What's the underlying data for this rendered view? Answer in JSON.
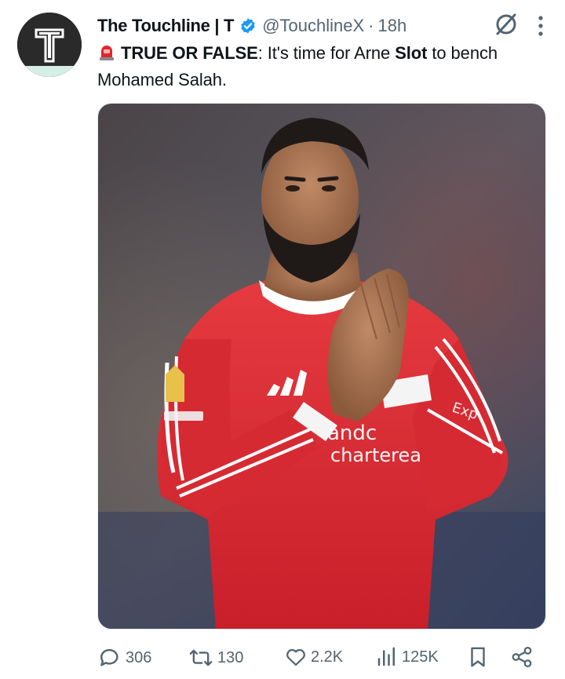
{
  "tweet": {
    "display_name": "The Touchline | T",
    "handle": "@TouchlineX",
    "separator": "·",
    "time": "18h",
    "text_bold_1": "TRUE OR FALSE",
    "text_part_2": ": It's time for Arne ",
    "text_bold_2": "Slot",
    "text_part_3": " to bench Mohamed Salah.",
    "avatar_letter": "T"
  },
  "jersey": {
    "sponsor_line_1": "andc",
    "sponsor_line_2": "charterea",
    "sleeve_text": "Exp"
  },
  "stats": {
    "replies": "306",
    "reposts": "130",
    "likes": "2.2K",
    "views": "125K"
  },
  "colors": {
    "verified": "#1d9bf0",
    "secondary_text": "#536471",
    "jersey_red": "#d8232f"
  },
  "icons": [
    "verified-badge-icon",
    "grok-icon",
    "more-icon",
    "siren-emoji-icon",
    "reply-icon",
    "repost-icon",
    "like-icon",
    "views-icon",
    "bookmark-icon",
    "share-icon"
  ]
}
